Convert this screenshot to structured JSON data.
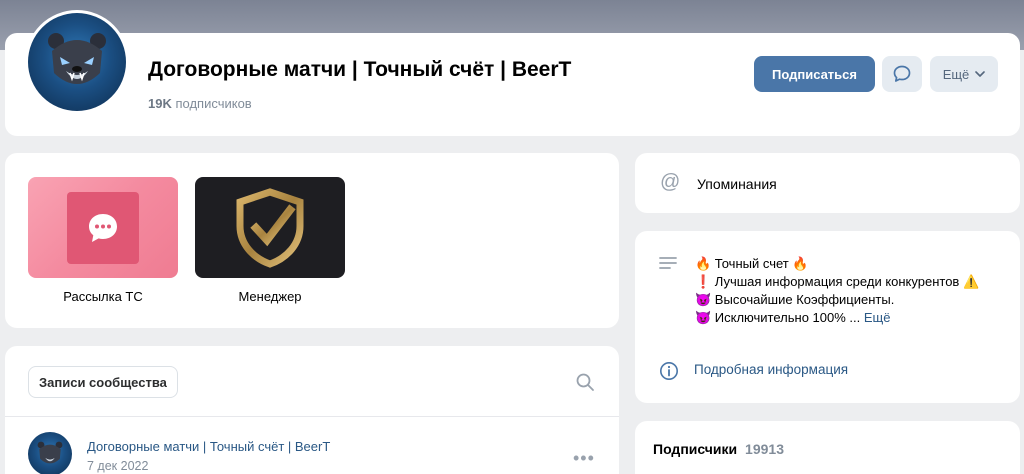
{
  "header": {
    "title": "Договорные матчи | Точный счёт | BeerT",
    "subscribers_count": "19K",
    "subscribers_label": "подписчиков",
    "subscribe_button": "Подписаться",
    "more_button": "Ещё",
    "accent_color": "#4a76a8"
  },
  "apps": [
    {
      "label": "Рассылка ТС",
      "icon": "chat-bubble-icon"
    },
    {
      "label": "Менеджер",
      "icon": "shield-check-icon"
    }
  ],
  "posts": {
    "tab_label": "Записи сообщества",
    "first_post": {
      "author": "Договорные матчи | Точный счёт | BeerT",
      "date": "7 дек 2022"
    }
  },
  "mentions": {
    "label": "Упоминания"
  },
  "about": {
    "line1": "🔥 Точный счет 🔥",
    "line2": "❗ Лучшая информация среди конкурентов ⚠️",
    "line3": "😈 Высочайшие Коэффициенты.",
    "line4": "😈 Исключительно 100% ...",
    "more": "Ещё",
    "details_link": "Подробная информация"
  },
  "subscribers_block": {
    "title": "Подписчики",
    "count": "19913"
  }
}
